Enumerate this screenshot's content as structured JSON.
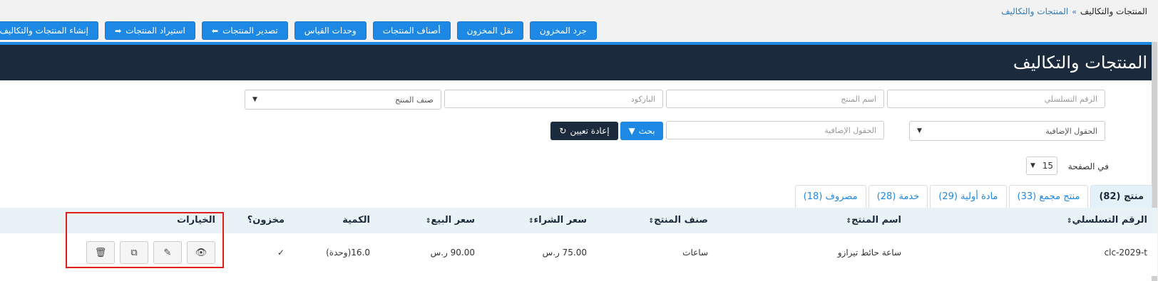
{
  "breadcrumb": {
    "root": "المنتجات والتكاليف",
    "separator": "»",
    "current": "المنتجات والتكاليف"
  },
  "toolbar": {
    "buttons": [
      {
        "label": "جرد المخزون",
        "icon": ""
      },
      {
        "label": "نقل المخزون",
        "icon": ""
      },
      {
        "label": "أصناف المنتجات",
        "icon": ""
      },
      {
        "label": "وحدات القياس",
        "icon": ""
      },
      {
        "label": "تصدير المنتجات",
        "icon": "export-icon"
      },
      {
        "label": "استيراد المنتجات",
        "icon": "import-icon"
      },
      {
        "label": "إنشاء المنتجات والتكاليف",
        "icon": "plus-icon"
      }
    ]
  },
  "page": {
    "title": "المنتجات والتكاليف"
  },
  "filters": {
    "serial_placeholder": "الرقم التسلسلي",
    "name_placeholder": "اسم المنتج",
    "barcode_placeholder": "الباركود",
    "category_select": "صنف المنتج",
    "extra_fields_select": "الحقول الإضافية",
    "extra_fields_placeholder": "الحقول الإضافية",
    "search_label": "بحث",
    "reset_label": "إعادة تعيين"
  },
  "pagination": {
    "per_page_label": "في الصفحة",
    "per_page_value": "15"
  },
  "tabs": [
    {
      "label": "منتج (82)",
      "active": true
    },
    {
      "label": "منتج مجمع (33)",
      "active": false
    },
    {
      "label": "مادة أولية (29)",
      "active": false
    },
    {
      "label": "خدمة (28)",
      "active": false
    },
    {
      "label": "مصروف (18)",
      "active": false
    }
  ],
  "table": {
    "headers": {
      "serial": "الرقم التسلسلي",
      "name": "اسم المنتج",
      "category": "صنف المنتج",
      "purchase_price": "سعر الشراء",
      "sale_price": "سعر البيع",
      "quantity": "الكمية",
      "stocked": "مخزون؟",
      "options": "الخيارات"
    },
    "rows": [
      {
        "serial": "clc-2029-t",
        "name": "ساعة حائط تيرازو",
        "category": "ساعات",
        "purchase_price": "75.00 ر.س",
        "sale_price": "90.00 ر.س",
        "quantity": "16.0(وحدة)",
        "stocked": "✓"
      }
    ]
  },
  "colors": {
    "primary": "#1e88e5",
    "header_dark": "#1b2a3c",
    "highlight": "#e21b1b"
  }
}
